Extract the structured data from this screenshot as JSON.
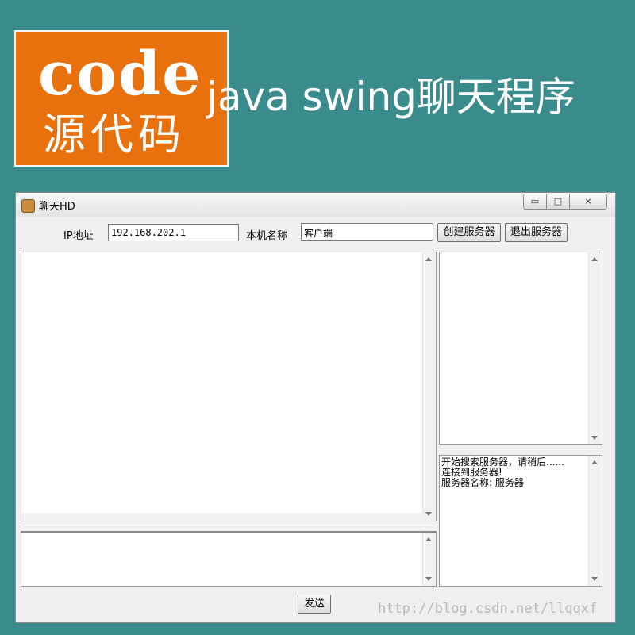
{
  "banner": {
    "logo_word": "code",
    "logo_subtitle": "源代码",
    "title": "java swing聊天程序"
  },
  "window": {
    "title": "聊天HD",
    "controls": {
      "minimize": "▭",
      "maximize": "□",
      "close": "⨯"
    }
  },
  "toolbar": {
    "ip_label": "IP地址",
    "ip_value": "192.168.202.1",
    "name_label": "本机名称",
    "name_value": "客户端",
    "create_server_label": "创建服务器",
    "exit_server_label": "退出服务器"
  },
  "status_log": {
    "lines": [
      "开始搜索服务器，请稍后......",
      "连接到服务器!",
      "服务器名称: 服务器"
    ]
  },
  "send_label": "发送",
  "watermark": "http://blog.csdn.net/llqqxf",
  "colors": {
    "background": "#3a8c8c",
    "logo_bg": "#e8700d",
    "window_bg": "#efefef"
  }
}
